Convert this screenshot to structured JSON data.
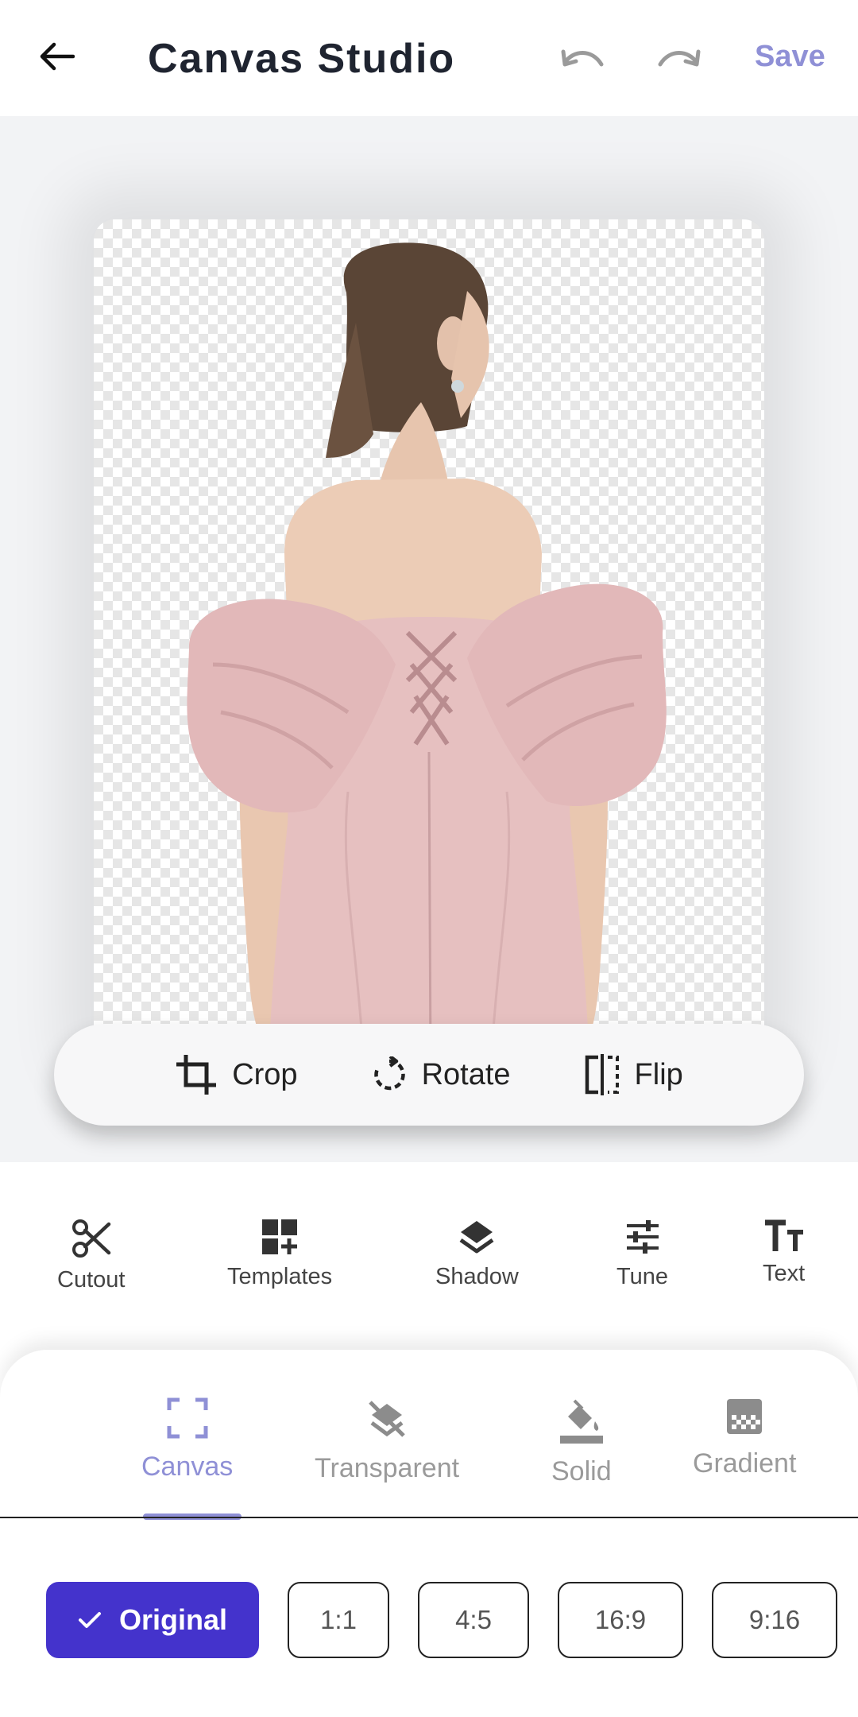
{
  "header": {
    "title": "Canvas Studio",
    "save_label": "Save",
    "icons": {
      "back": "arrow-left-icon",
      "undo": "undo-icon",
      "redo": "redo-icon"
    }
  },
  "canvas": {
    "background": "transparent-checkerboard",
    "subject": "woman in pink off-shoulder dress, back view"
  },
  "float_bar": {
    "crop_label": "Crop",
    "rotate_label": "Rotate",
    "flip_label": "Flip"
  },
  "tools": [
    {
      "label": "Cutout",
      "icon": "scissors-icon"
    },
    {
      "label": "Templates",
      "icon": "templates-icon"
    },
    {
      "label": "Shadow",
      "icon": "layers-icon"
    },
    {
      "label": "Tune",
      "icon": "tune-icon"
    },
    {
      "label": "Text",
      "icon": "text-icon"
    }
  ],
  "tabs": [
    {
      "label": "Canvas",
      "icon": "canvas-frame-icon",
      "active": true
    },
    {
      "label": "Transparent",
      "icon": "transparent-icon",
      "active": false
    },
    {
      "label": "Solid",
      "icon": "paint-bucket-icon",
      "active": false
    },
    {
      "label": "Gradient",
      "icon": "gradient-icon",
      "active": false
    }
  ],
  "ratios": [
    {
      "label": "Original",
      "selected": true
    },
    {
      "label": "1:1",
      "selected": false
    },
    {
      "label": "4:5",
      "selected": false
    },
    {
      "label": "16:9",
      "selected": false
    },
    {
      "label": "9:16",
      "selected": false
    }
  ],
  "colors": {
    "accent": "#8f90d6",
    "primary": "#4433cc",
    "canvas_bg": "#f2f3f5"
  }
}
